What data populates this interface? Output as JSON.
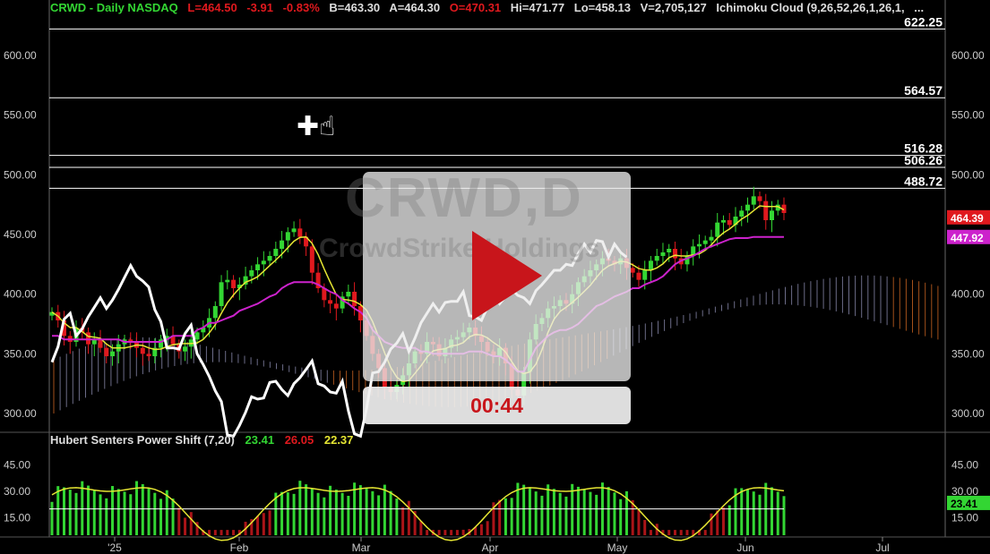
{
  "header": {
    "symbol": "CRWD - Daily  NASDAQ",
    "last": "L=464.50",
    "change": "-3.91",
    "change_pct": "-0.83%",
    "bid": "B=463.30",
    "ask": "A=464.30",
    "open": "O=470.31",
    "high": "Hi=471.77",
    "low": "Lo=458.13",
    "volume": "V=2,705,127",
    "study": "Ichimoku Cloud (9,26,52,26,1,26,1,",
    "more": "..."
  },
  "indicator": {
    "name": "Hubert Senters Power Shift (7,20)",
    "v1": "23.41",
    "v2": "26.05",
    "v3": "22.37",
    "badge": "23.41",
    "badge_hidden": "30.00"
  },
  "levels": [
    "622.25",
    "564.57",
    "516.28",
    "506.26",
    "488.72"
  ],
  "price_badges": {
    "last": "464.39",
    "kijun": "447.92"
  },
  "watermark": {
    "ticker": "CRWD,D",
    "name": "CrowdStrike Holdings"
  },
  "video": {
    "timer": "00:44"
  },
  "colors": {
    "up": "#33d633",
    "down": "#e0191e",
    "tenkan": "#e6e633",
    "kijun": "#cc22cc",
    "lagging": "#ffffff"
  },
  "chart_data": {
    "type": "candlestick",
    "price_axis": {
      "ticks": [
        "600.00",
        "550.00",
        "500.00",
        "450.00",
        "400.00",
        "350.00",
        "300.00"
      ],
      "ylim": [
        285,
        630
      ]
    },
    "indicator_axis": {
      "ticks": [
        "45.00",
        "30.00",
        "15.00"
      ],
      "ylim": [
        5,
        55
      ]
    },
    "x_labels": [
      "'25",
      "Feb",
      "Mar",
      "Apr",
      "May",
      "Jun",
      "Jul"
    ],
    "horizontal_levels": [
      622.25,
      564.57,
      516.28,
      506.26,
      488.72
    ],
    "close": [
      385,
      378,
      365,
      360,
      372,
      368,
      358,
      362,
      355,
      348,
      352,
      358,
      362,
      360,
      355,
      350,
      348,
      355,
      362,
      365,
      358,
      352,
      356,
      362,
      368,
      372,
      380,
      390,
      410,
      412,
      405,
      408,
      415,
      420,
      425,
      428,
      432,
      438,
      445,
      452,
      455,
      448,
      440,
      418,
      405,
      395,
      392,
      388,
      398,
      402,
      390,
      378,
      365,
      350,
      338,
      322,
      318,
      324,
      332,
      342,
      352,
      350,
      360,
      358,
      348,
      355,
      362,
      364,
      368,
      372,
      365,
      360,
      352,
      348,
      355,
      342,
      320,
      315,
      335,
      362,
      375,
      380,
      388,
      390,
      395,
      392,
      400,
      410,
      415,
      420,
      425,
      430,
      428,
      425,
      430,
      422,
      418,
      412,
      420,
      428,
      432,
      435,
      438,
      430,
      425,
      432,
      440,
      442,
      445,
      448,
      460,
      462,
      458,
      465,
      470,
      475,
      482,
      478,
      462,
      470,
      475,
      468
    ],
    "kijun": [
      365,
      365,
      362,
      362,
      362,
      362,
      362,
      362,
      362,
      362,
      362,
      362,
      360,
      360,
      360,
      360,
      360,
      360,
      360,
      362,
      365,
      365,
      365,
      365,
      370,
      372,
      376,
      376,
      378,
      380,
      382,
      386,
      388,
      390,
      392,
      395,
      398,
      400,
      405,
      408,
      410,
      410,
      410,
      410,
      408,
      405,
      402,
      400,
      395,
      392,
      388,
      385,
      380,
      370,
      365,
      360,
      358,
      356,
      355,
      355,
      355,
      352,
      352,
      350,
      350,
      350,
      350,
      350,
      350,
      352,
      352,
      352,
      350,
      348,
      348,
      345,
      340,
      335,
      335,
      345,
      355,
      360,
      365,
      368,
      370,
      370,
      372,
      375,
      380,
      385,
      390,
      392,
      395,
      398,
      400,
      402,
      405,
      405,
      408,
      410,
      412,
      415,
      420,
      425,
      428,
      430,
      432,
      435,
      438,
      440,
      442,
      444,
      446,
      447,
      447,
      447,
      448,
      448,
      448,
      448,
      448,
      448
    ]
  }
}
